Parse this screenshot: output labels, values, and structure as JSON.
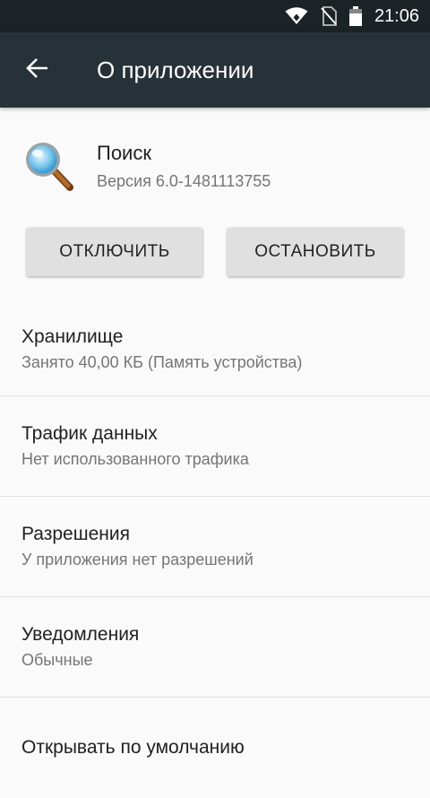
{
  "status_bar": {
    "time": "21:06",
    "icons": [
      "wifi-icon",
      "no-sim-icon",
      "battery-icon"
    ]
  },
  "toolbar": {
    "back_icon": "arrow-back-icon",
    "title": "О приложении"
  },
  "app": {
    "icon": "magnifier-icon",
    "name": "Поиск",
    "version": "Версия 6.0-1481113755"
  },
  "actions": {
    "disable_label": "ОТКЛЮЧИТЬ",
    "stop_label": "ОСТАНОВИТЬ"
  },
  "settings": [
    {
      "title": "Хранилище",
      "subtitle": "Занято 40,00 КБ (Память устройства)"
    },
    {
      "title": "Трафик данных",
      "subtitle": "Нет использованного трафика"
    },
    {
      "title": "Разрешения",
      "subtitle": "У приложения нет разрешений"
    },
    {
      "title": "Уведомления",
      "subtitle": "Обычные"
    },
    {
      "title": "Открывать по умолчанию",
      "subtitle": ""
    }
  ],
  "colors": {
    "status_bar": "#1c2326",
    "toolbar": "#263238",
    "background": "#fafafa",
    "button": "#e0e0e0"
  }
}
